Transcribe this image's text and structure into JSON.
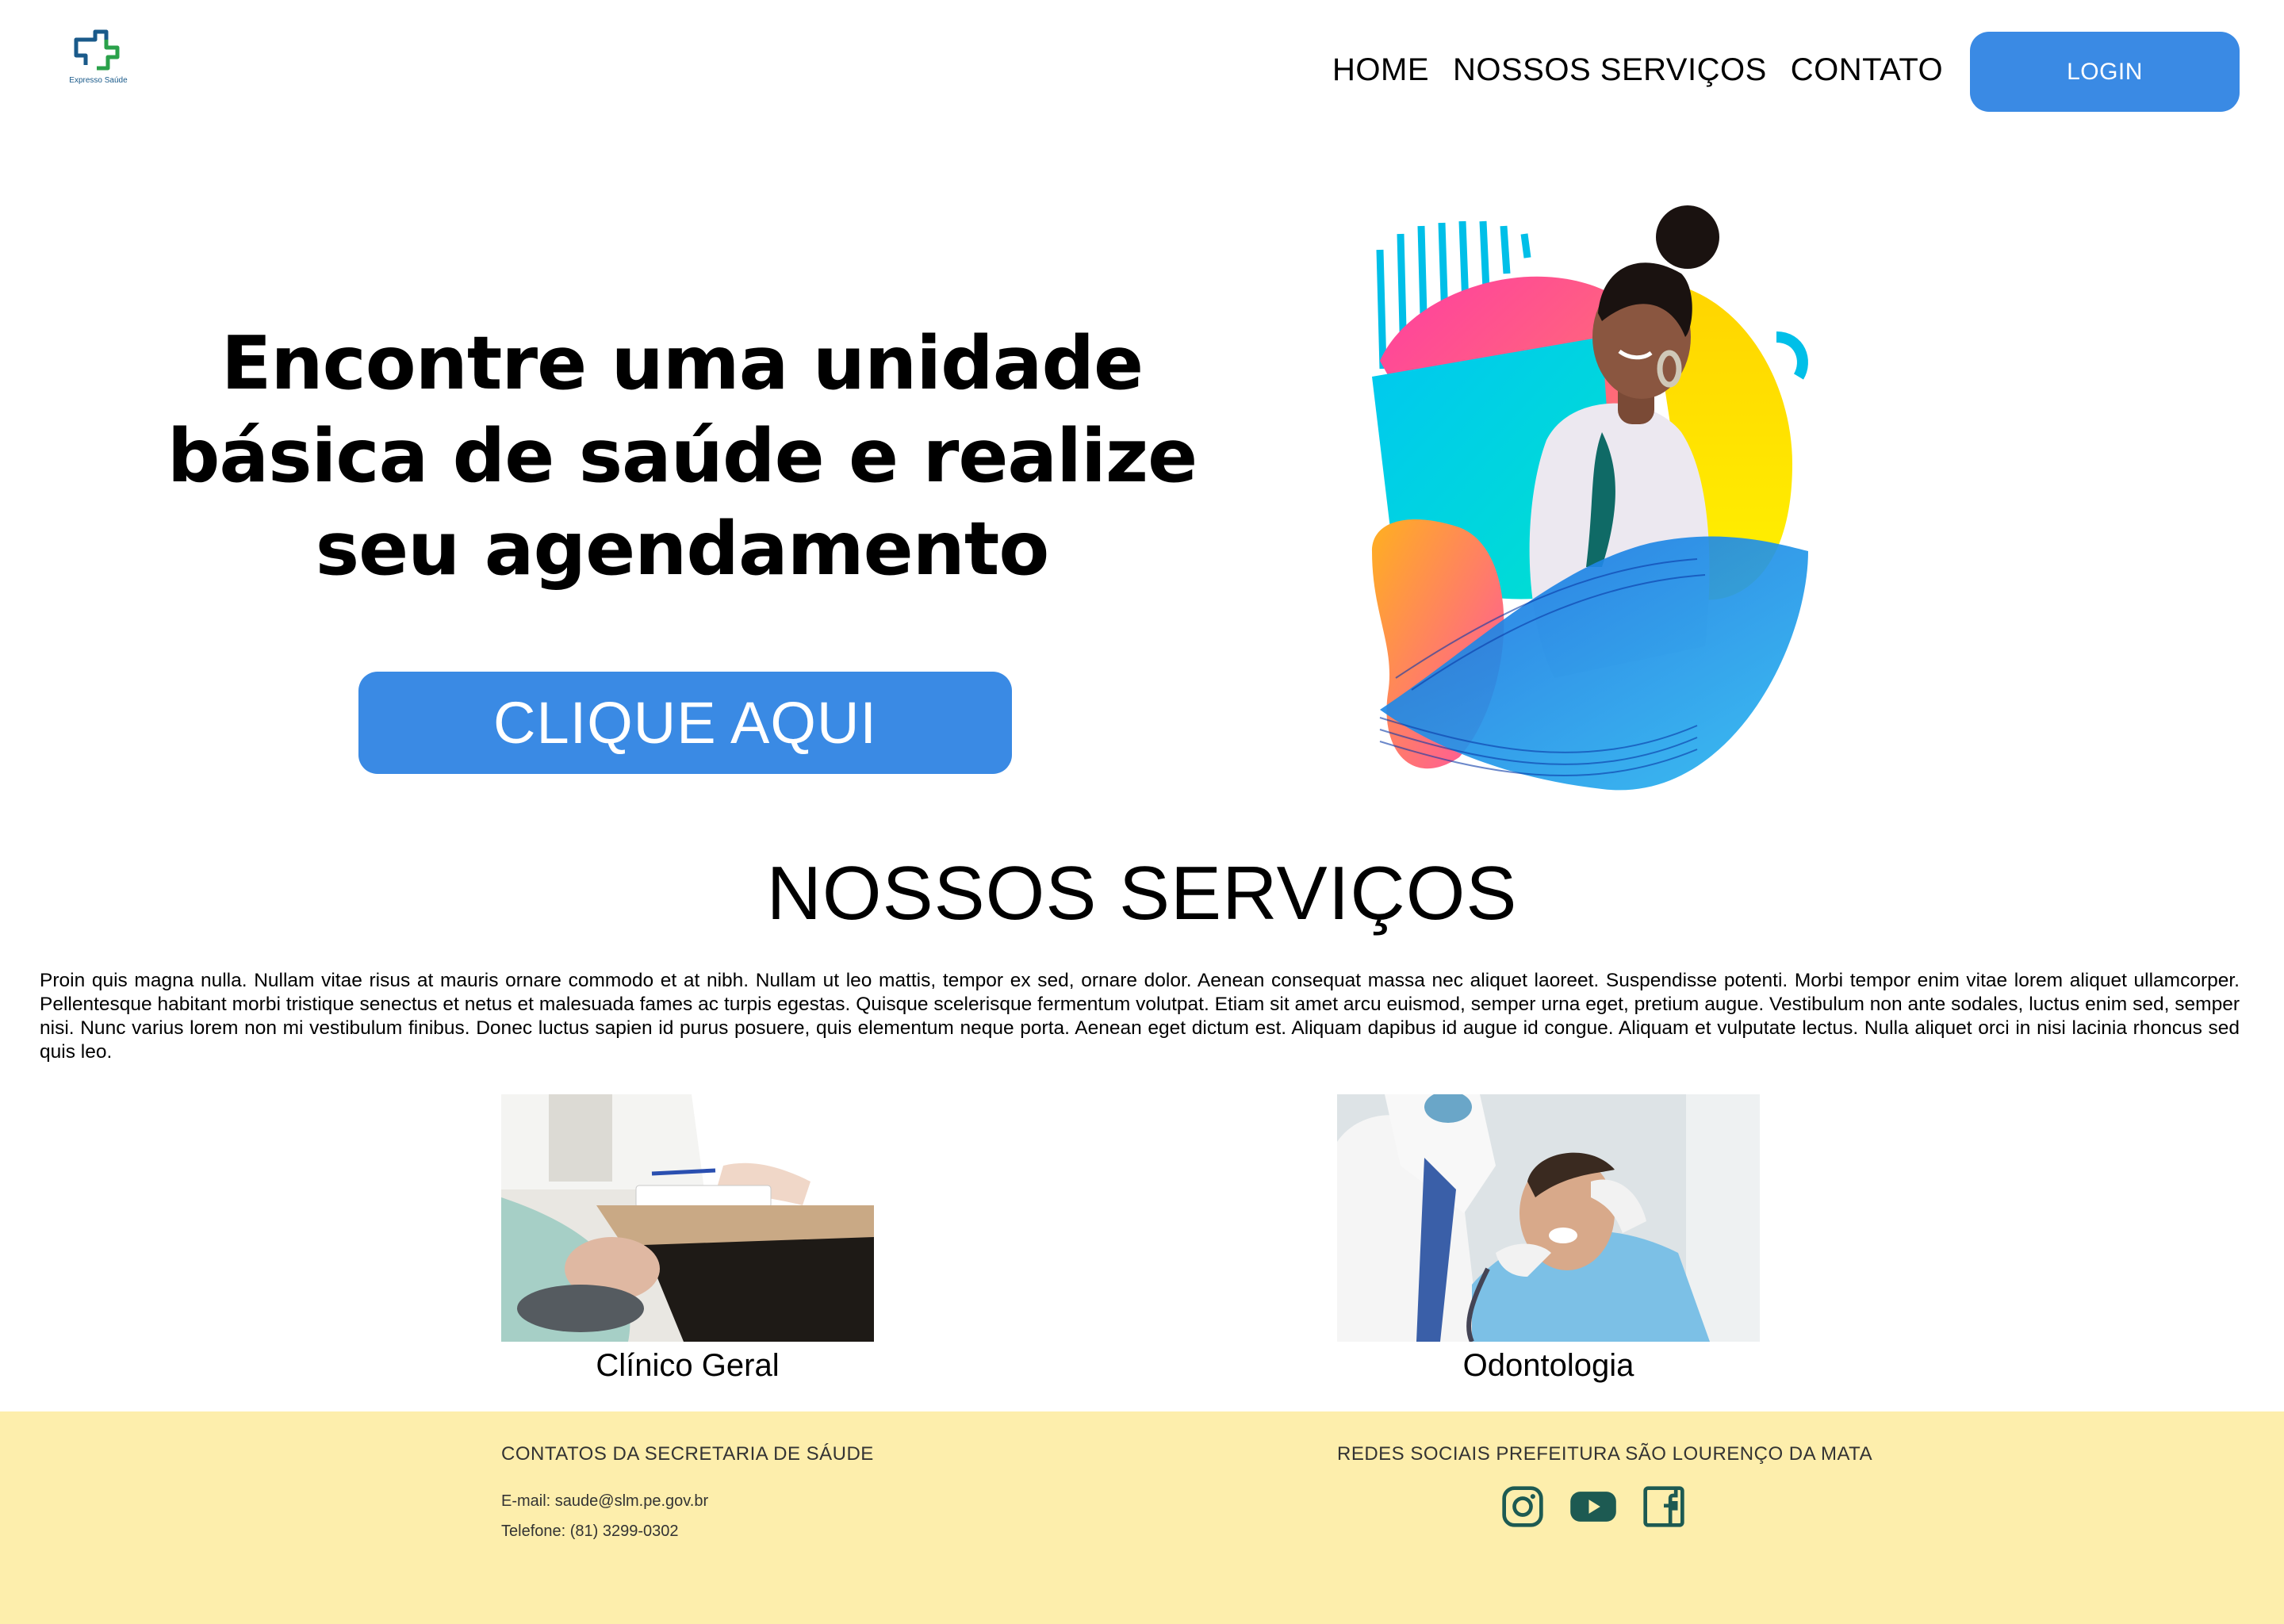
{
  "brand": {
    "logo_text": "Expresso Saúde"
  },
  "nav": {
    "links": [
      {
        "label": "HOME"
      },
      {
        "label": "NOSSOS SERVIÇOS"
      },
      {
        "label": "CONTATO"
      }
    ],
    "login_label": "LOGIN"
  },
  "hero": {
    "title": "Encontre uma unidade básica de saúde e realize seu agendamento",
    "cta_label": "CLIQUE AQUI"
  },
  "services": {
    "title": "NOSSOS SERVIÇOS",
    "description": "Proin quis magna nulla. Nullam vitae risus at mauris ornare commodo et at nibh. Nullam ut leo mattis, tempor ex sed, ornare dolor. Aenean consequat massa nec aliquet laoreet. Suspendisse potenti. Morbi tempor enim vitae lorem aliquet ullamcorper. Pellentesque habitant morbi tristique senectus et netus et malesuada fames ac turpis egestas. Quisque scelerisque fermentum volutpat. Etiam sit amet arcu euismod, semper urna eget, pretium augue. Vestibulum non ante sodales, luctus enim sed, semper nisi. Nunc varius lorem non mi vestibulum finibus. Donec luctus sapien id purus posuere, quis elementum neque porta. Aenean eget dictum est. Aliquam dapibus id augue id congue. Aliquam et vulputate lectus. Nulla aliquet orci in nisi lacinia rhoncus sed quis leo.",
    "items": [
      {
        "label": "Clínico Geral"
      },
      {
        "label": "Odontologia"
      }
    ]
  },
  "footer": {
    "contacts_title": "CONTATOS DA SECRETARIA DE SÁUDE",
    "email": "E-mail: saude@slm.pe.gov.br",
    "phone": "Telefone: (81) 3299-0302",
    "social_title": "REDES SOCIAIS PREFEITURA SÃO LOURENÇO DA MATA",
    "social_icons": [
      "instagram-icon",
      "youtube-icon",
      "facebook-icon"
    ]
  },
  "colors": {
    "primary_button": "#3a8ae4",
    "footer_bg": "#fdeeac",
    "social_icon": "#1d5a52"
  }
}
